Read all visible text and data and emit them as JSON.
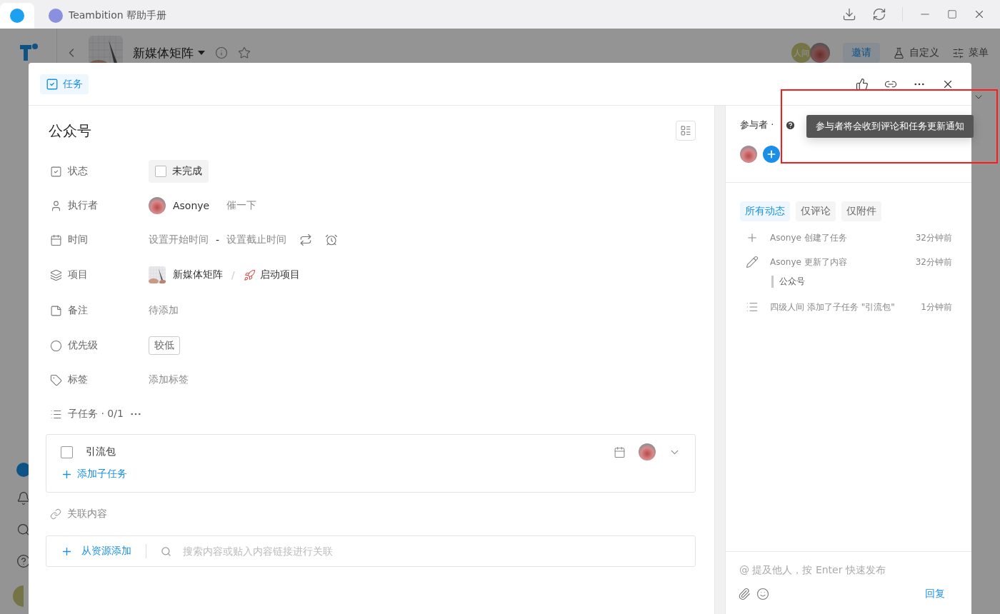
{
  "browser_tabs": [
    {
      "selected": true
    },
    {
      "label": "Teambition 帮助手册",
      "selected": false
    }
  ],
  "project_header": {
    "title": "新媒体矩阵",
    "member_initials": "人间",
    "invite": "邀请",
    "customize": "自定义",
    "menu": "菜单"
  },
  "task_dialog": {
    "type_label": "任务",
    "title": "公众号",
    "fields": [
      {
        "kind": "status",
        "label": "状态",
        "value": "未完成",
        "checked": false
      },
      {
        "kind": "assignee",
        "label": "执行者",
        "value": "Asonye",
        "action": "催一下"
      },
      {
        "kind": "time",
        "label": "时间",
        "start": "设置开始时间",
        "separator": "-",
        "end": "设置截止时间"
      },
      {
        "kind": "project",
        "label": "项目",
        "value": "新媒体矩阵",
        "separator": "/",
        "stage": "启动项目"
      },
      {
        "kind": "note",
        "label": "备注",
        "value": "待添加"
      },
      {
        "kind": "priority",
        "label": "优先级",
        "value": "较低"
      },
      {
        "kind": "tags",
        "label": "标签",
        "value": "添加标签"
      }
    ],
    "subtasks": {
      "label": "子任务 · 0/1",
      "items": [
        {
          "title": "引流包",
          "checked": false
        }
      ],
      "add": "添加子任务"
    },
    "links": {
      "label": "关联内容",
      "add": "从资源添加",
      "search_placeholder": "搜索内容或贴入内容链接进行关联"
    }
  },
  "activity_panel": {
    "participants_label": "参与者 ·",
    "tooltip": "参与者将会收到评论和任务更新通知",
    "filters": [
      {
        "label": "所有动态",
        "selected": true
      },
      {
        "label": "仅评论",
        "selected": false
      },
      {
        "label": "仅附件",
        "selected": false
      }
    ],
    "events": [
      {
        "kind": "create",
        "text": "Asonye 创建了任务",
        "time": "32分钟前"
      },
      {
        "kind": "update",
        "text": "Asonye 更新了内容",
        "time": "32分钟前",
        "quote": "公众号"
      },
      {
        "kind": "subtask",
        "text": "四级人间 添加了子任务 \"引流包\"",
        "time": "1分钟前"
      }
    ],
    "comment_placeholder": "@ 提及他人，按 Enter 快速发布",
    "reply": "回复"
  }
}
